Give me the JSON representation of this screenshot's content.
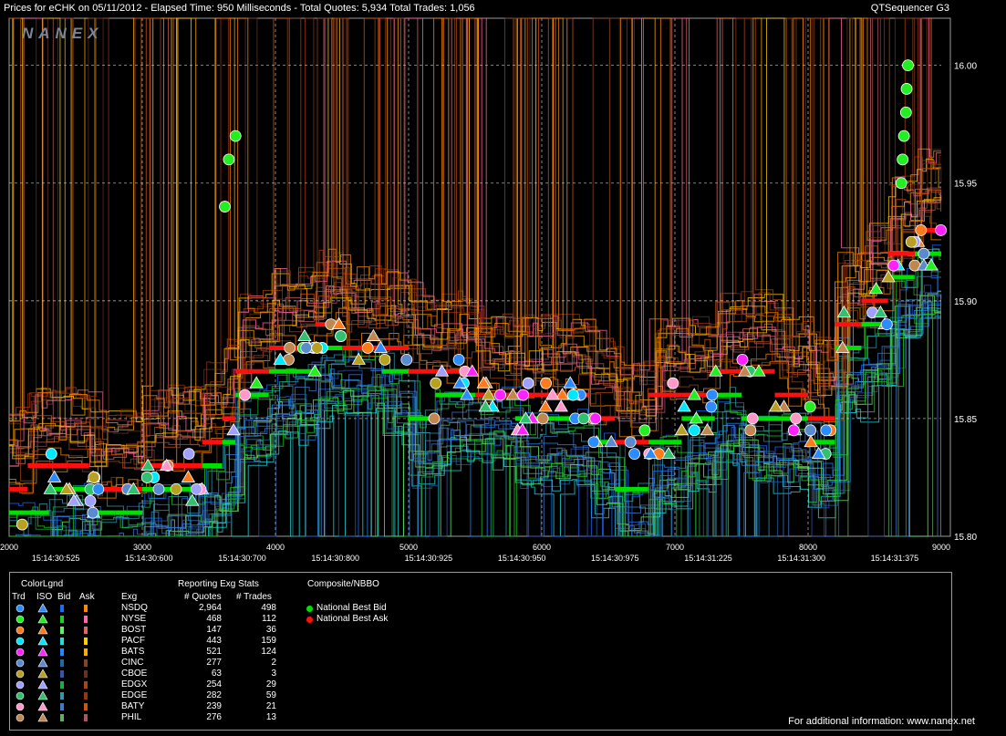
{
  "header": {
    "title": "Prices for  eCHK  on  05/11/2012  -  Elapsed Time: 950 Milliseconds  -  Total Quotes: 5,934  Total Trades: 1,056",
    "app_name": "QTSequencer G3",
    "logo": "NANEX"
  },
  "chart_data": {
    "type": "line",
    "title": "Prices for  eCHK  on  05/11/2012",
    "x_sequence_ticks": [
      "2000",
      "3000",
      "4000",
      "5000",
      "6000",
      "7000",
      "8000",
      "9000"
    ],
    "x_time_labels": [
      "15:14:30:525",
      "15:14:30:600",
      "15:14:30:700",
      "15:14:30:800",
      "15:14:30:925",
      "15:14:30:950",
      "15:14:30:975",
      "15:14:31:225",
      "15:14:31:300",
      "15:14:31:375"
    ],
    "xlim": [
      2000,
      9000
    ],
    "y_ticks": [
      "16.00",
      "15.95",
      "15.90",
      "15.85",
      "15.80"
    ],
    "ylim": [
      15.8,
      16.02
    ],
    "grid": true,
    "series": [
      {
        "name": "National Best Bid",
        "color": "#00e000",
        "x": [
          2000,
          2140,
          2300,
          2450,
          2600,
          2800,
          3000,
          3200,
          3450,
          3600,
          3700,
          3800,
          3950,
          4100,
          4300,
          4500,
          4800,
          5000,
          5200,
          5500,
          5800,
          6100,
          6350,
          6550,
          6800,
          7050,
          7300,
          7500,
          7750,
          8000,
          8200,
          8400,
          8600,
          8800,
          9000
        ],
        "y": [
          15.81,
          15.81,
          15.82,
          15.82,
          15.81,
          15.81,
          15.82,
          15.82,
          15.83,
          15.84,
          15.86,
          15.86,
          15.87,
          15.87,
          15.88,
          15.88,
          15.87,
          15.85,
          15.86,
          15.86,
          15.85,
          15.85,
          15.84,
          15.82,
          15.84,
          15.85,
          15.86,
          15.85,
          15.85,
          15.84,
          15.88,
          15.89,
          15.91,
          15.92,
          15.92
        ]
      },
      {
        "name": "National Best Ask",
        "color": "#ff1010",
        "x": [
          2000,
          2140,
          2300,
          2450,
          2600,
          2800,
          3000,
          3200,
          3450,
          3600,
          3700,
          3800,
          3950,
          4100,
          4300,
          4500,
          4800,
          5000,
          5200,
          5500,
          5800,
          6100,
          6350,
          6550,
          6800,
          7050,
          7300,
          7500,
          7750,
          8000,
          8200,
          8400,
          8600,
          8800,
          9000
        ],
        "y": [
          15.82,
          15.83,
          15.83,
          15.83,
          15.82,
          15.82,
          15.83,
          15.83,
          15.84,
          15.85,
          15.87,
          15.87,
          15.88,
          15.88,
          15.89,
          15.88,
          15.88,
          15.87,
          15.87,
          15.86,
          15.86,
          15.86,
          15.85,
          15.84,
          15.86,
          15.86,
          15.87,
          15.87,
          15.86,
          15.85,
          15.89,
          15.9,
          15.92,
          15.93,
          15.93
        ]
      }
    ],
    "annotations": [
      "For additional information: www.nanex.net"
    ]
  },
  "legend": {
    "color_legend_title": "ColorLgnd",
    "col_headers": [
      "Trd",
      "ISO",
      "Bid",
      "Ask",
      "Exg"
    ],
    "stats_title": "Reporting Exg Stats",
    "stats_headers": [
      "# Quotes",
      "# Trades"
    ],
    "composite_title": "Composite/NBBO",
    "composite_items": [
      {
        "label": "National Best Bid",
        "color": "#00e000"
      },
      {
        "label": "National Best Ask",
        "color": "#ff1010"
      }
    ],
    "exchanges": [
      {
        "name": "NSDQ",
        "quotes": "2,964",
        "trades": "498",
        "trd_color": "#2a8cff",
        "bid_color": "#1a6cff",
        "ask_color": "#ff8800"
      },
      {
        "name": "NYSE",
        "quotes": "468",
        "trades": "112",
        "trd_color": "#22ee22",
        "bid_color": "#22cc22",
        "ask_color": "#ff66aa"
      },
      {
        "name": "BOST",
        "quotes": "147",
        "trades": "36",
        "trd_color": "#ff7a1a",
        "bid_color": "#66ee66",
        "ask_color": "#dd6666"
      },
      {
        "name": "PACF",
        "quotes": "443",
        "trades": "159",
        "trd_color": "#00e8ff",
        "bid_color": "#22dddd",
        "ask_color": "#ffcc00"
      },
      {
        "name": "BATS",
        "quotes": "521",
        "trades": "124",
        "trd_color": "#ff22ff",
        "bid_color": "#2288ff",
        "ask_color": "#ffaa00"
      },
      {
        "name": "CINC",
        "quotes": "277",
        "trades": "2",
        "trd_color": "#5a8ad0",
        "bid_color": "#2266aa",
        "ask_color": "#884422"
      },
      {
        "name": "CBOE",
        "quotes": "63",
        "trades": "3",
        "trd_color": "#b8a020",
        "bid_color": "#3355aa",
        "ask_color": "#663322"
      },
      {
        "name": "EDGX",
        "quotes": "254",
        "trades": "29",
        "trd_color": "#a0a0ff",
        "bid_color": "#22aa44",
        "ask_color": "#aa4411"
      },
      {
        "name": "EDGE",
        "quotes": "282",
        "trades": "59",
        "trd_color": "#30c070",
        "bid_color": "#3399aa",
        "ask_color": "#993311"
      },
      {
        "name": "BATY",
        "quotes": "239",
        "trades": "21",
        "trd_color": "#ff99cc",
        "bid_color": "#4477cc",
        "ask_color": "#cc5511"
      },
      {
        "name": "PHIL",
        "quotes": "276",
        "trades": "13",
        "trd_color": "#c08850",
        "bid_color": "#66aa66",
        "ask_color": "#aa5566"
      }
    ]
  },
  "footer": {
    "info_text": "For additional information: www.nanex.net"
  }
}
